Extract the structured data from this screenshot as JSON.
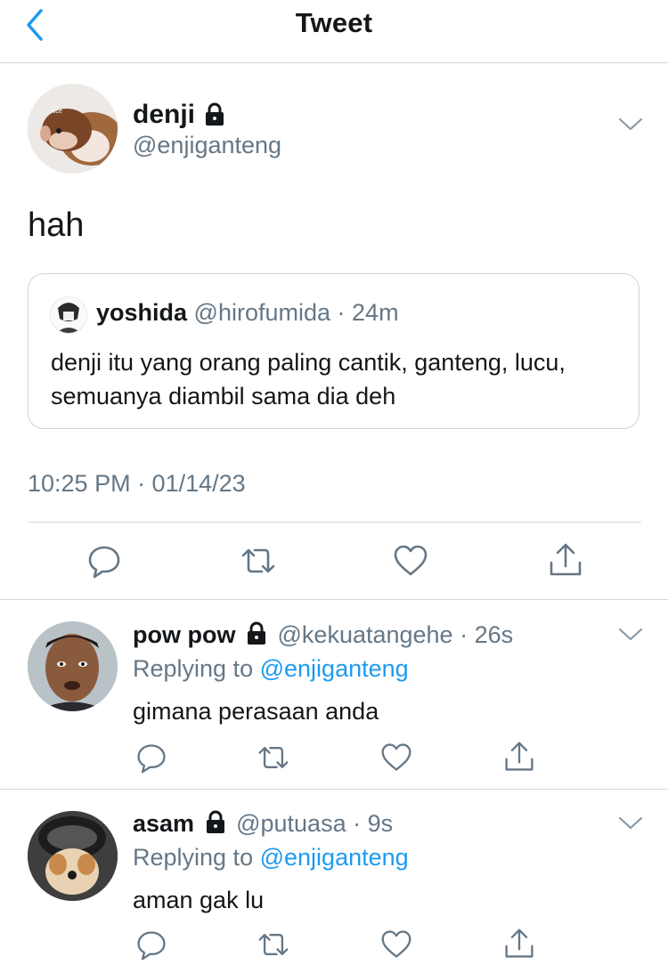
{
  "header": {
    "title": "Tweet"
  },
  "tweet": {
    "name": "denji",
    "handle": "@enjiganteng",
    "text": "hah",
    "avatar_text": "nice",
    "timestamp": "10:25 PM · 01/14/23",
    "quote": {
      "name": "yoshida",
      "handle": "@hirofumida",
      "time": "· 24m",
      "text": "denji itu yang orang paling cantik, ganteng, lucu, semuanya diambil sama dia deh"
    }
  },
  "replies": [
    {
      "name": "pow pow",
      "handle": "@kekuatangehe",
      "time": "· 26s",
      "replying_prefix": "Replying to",
      "replying_to": "@enjiganteng",
      "text": "gimana perasaan anda"
    },
    {
      "name": "asam",
      "handle": "@putuasa",
      "time": "· 9s",
      "replying_prefix": "Replying to",
      "replying_to": "@enjiganteng",
      "text": "aman gak lu"
    }
  ],
  "colors": {
    "accent": "#1d9bf0",
    "muted": "#657786",
    "text": "#14171a",
    "border": "#d4d7da"
  },
  "icons": [
    "back-chevron-icon",
    "lock-icon",
    "chevron-down-icon",
    "reply-icon",
    "retweet-icon",
    "like-icon",
    "share-icon"
  ]
}
